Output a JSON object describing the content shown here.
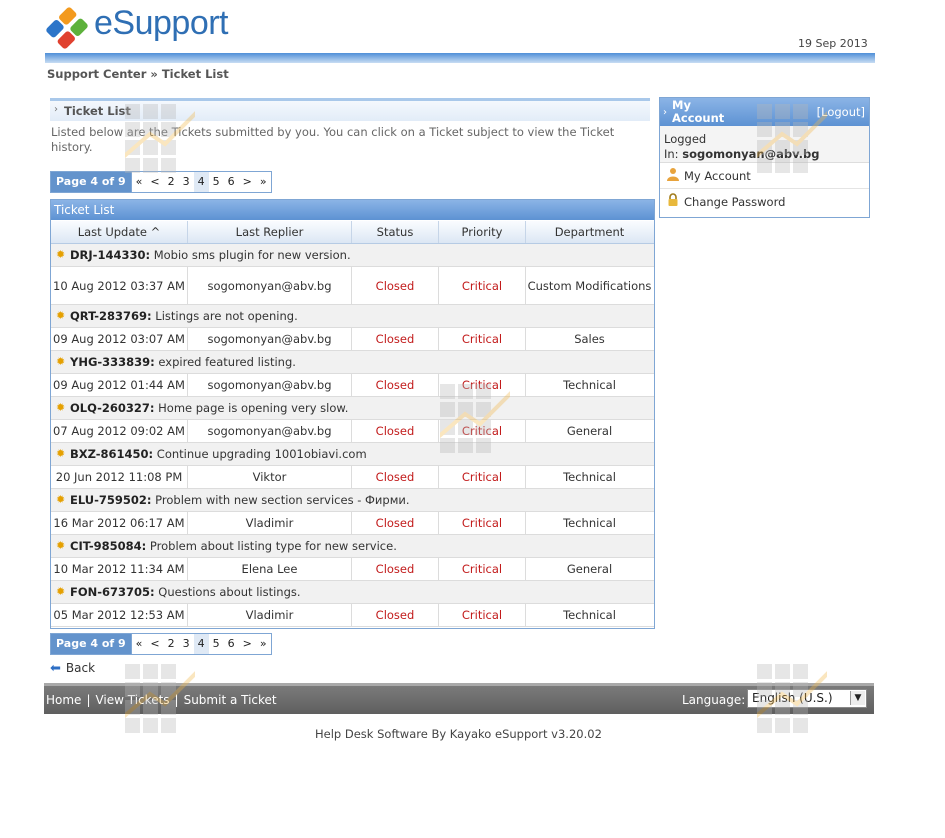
{
  "header": {
    "logo_text": "eSupport",
    "date": "19 Sep 2013"
  },
  "breadcrumb": "Support Center » Ticket List",
  "section": {
    "title": "Ticket List",
    "intro": "Listed below are the Tickets submitted by you. You can click on a Ticket subject to view the Ticket history."
  },
  "pager": {
    "label": "Page 4 of 9",
    "first": "«",
    "prev": "<",
    "pages": [
      "2",
      "3",
      "4",
      "5",
      "6"
    ],
    "current": "4",
    "next": ">",
    "last": "»"
  },
  "table": {
    "title": "Ticket List",
    "columns": [
      "Last Update ^",
      "Last Replier",
      "Status",
      "Priority",
      "Department"
    ],
    "tickets": [
      {
        "id": "DRJ-144330:",
        "subject": " Mobio sms plugin for new version.",
        "last_update": "10 Aug 2012 03:37 AM",
        "replier": "sogomonyan@abv.bg",
        "status": "Closed",
        "priority": "Critical",
        "department": "Custom Modifications"
      },
      {
        "id": "QRT-283769:",
        "subject": " Listings are not opening.",
        "last_update": "09 Aug 2012 03:07 AM",
        "replier": "sogomonyan@abv.bg",
        "status": "Closed",
        "priority": "Critical",
        "department": "Sales"
      },
      {
        "id": "YHG-333839:",
        "subject": " expired featured listing.",
        "last_update": "09 Aug 2012 01:44 AM",
        "replier": "sogomonyan@abv.bg",
        "status": "Closed",
        "priority": "Critical",
        "department": "Technical"
      },
      {
        "id": "OLQ-260327:",
        "subject": " Home page is opening very slow.",
        "last_update": "07 Aug 2012 09:02 AM",
        "replier": "sogomonyan@abv.bg",
        "status": "Closed",
        "priority": "Critical",
        "department": "General"
      },
      {
        "id": "BXZ-861450:",
        "subject": " Continue upgrading 1001obiavi.com",
        "last_update": "20 Jun 2012 11:08 PM",
        "replier": "Viktor",
        "status": "Closed",
        "priority": "Critical",
        "department": "Technical"
      },
      {
        "id": "ELU-759502:",
        "subject": " Problem with new section services - Фирми.",
        "last_update": "16 Mar 2012 06:17 AM",
        "replier": "Vladimir",
        "status": "Closed",
        "priority": "Critical",
        "department": "Technical"
      },
      {
        "id": "CIT-985084:",
        "subject": " Problem about listing type for new service.",
        "last_update": "10 Mar 2012 11:34 AM",
        "replier": "Elena Lee",
        "status": "Closed",
        "priority": "Critical",
        "department": "General"
      },
      {
        "id": "FON-673705:",
        "subject": " Questions about listings.",
        "last_update": "05 Mar 2012 12:53 AM",
        "replier": "Vladimir",
        "status": "Closed",
        "priority": "Critical",
        "department": "Technical"
      }
    ]
  },
  "sidebar": {
    "title": "My Account",
    "logout": "[Logout]",
    "logged_label": "Logged",
    "logged_in_label": "In:",
    "username": "sogomonyan@abv.bg",
    "links": [
      "My Account",
      "Change Password"
    ]
  },
  "back_label": "Back",
  "footer": {
    "nav": [
      "Home",
      "View Tickets",
      "Submit a Ticket"
    ],
    "language_label": "Language:",
    "language_value": "English (U.S.)",
    "powered": "Help Desk Software By Kayako eSupport v3.20.02"
  },
  "colors": {
    "accent": "#5d92d3",
    "critical": "#c21b1b",
    "closed": "#c21b1b"
  }
}
